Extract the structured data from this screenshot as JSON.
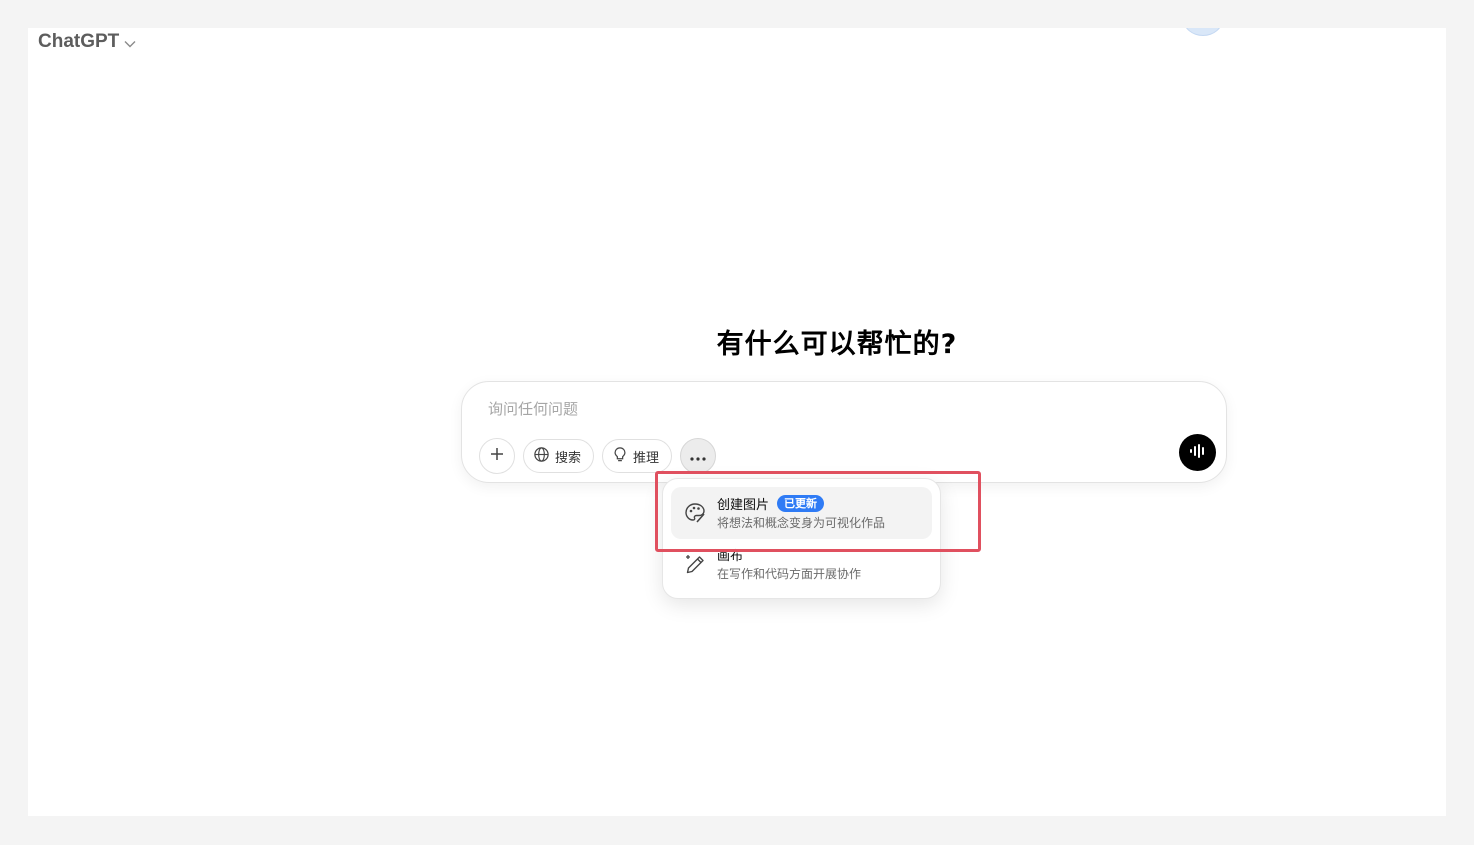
{
  "header": {
    "model_name": "ChatGPT",
    "model_dropdown_icon": "chevron-down-icon"
  },
  "main": {
    "headline": "有什么可以帮忙的?"
  },
  "composer": {
    "placeholder": "询问任何问题",
    "value": "",
    "attach_icon": "plus-icon",
    "search_label": "搜索",
    "search_icon": "globe-icon",
    "reason_label": "推理",
    "reason_icon": "lightbulb-icon",
    "more_icon": "more-horizontal-icon",
    "voice_icon": "voice-waveform-icon"
  },
  "tools_menu": {
    "items": [
      {
        "title": "创建图片",
        "badge": "已更新",
        "description": "将想法和概念变身为可视化作品",
        "icon": "palette-icon"
      },
      {
        "title": "画布",
        "description": "在写作和代码方面开展协作",
        "icon": "pen-sparkle-icon"
      }
    ]
  },
  "colors": {
    "badge": "#2f7bf5",
    "annotation_box": "#e0505f",
    "voice_button": "#000000"
  }
}
